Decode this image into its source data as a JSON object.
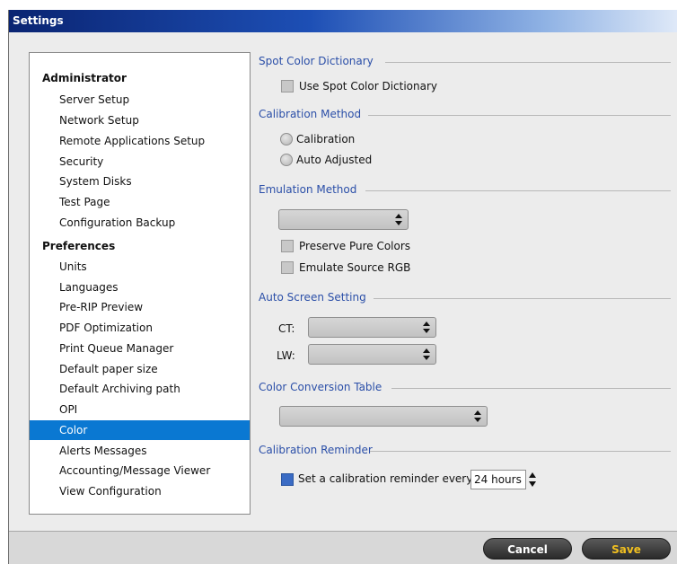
{
  "window": {
    "title": "Settings"
  },
  "tree": {
    "groups": [
      {
        "label": "Administrator",
        "items": [
          "Server Setup",
          "Network Setup",
          "Remote Applications Setup",
          "Security",
          "System Disks",
          "Test Page",
          "Configuration Backup"
        ]
      },
      {
        "label": "Preferences",
        "items": [
          "Units",
          "Languages",
          "Pre-RIP Preview",
          "PDF Optimization",
          "Print Queue Manager",
          "Default paper size",
          "Default Archiving path",
          "OPI",
          "Color",
          "Alerts Messages",
          "Accounting/Message Viewer",
          "View Configuration"
        ]
      }
    ],
    "selected": "Color"
  },
  "spot_color": {
    "header": "Spot Color Dictionary",
    "checkbox_label": "Use Spot Color Dictionary",
    "checked": false
  },
  "calibration_method": {
    "header": "Calibration Method",
    "options": [
      "Calibration",
      "Auto Adjusted"
    ]
  },
  "emulation_method": {
    "header": "Emulation Method",
    "select_value": "",
    "preserve_label": "Preserve Pure Colors",
    "emulate_label": "Emulate Source RGB"
  },
  "auto_screen": {
    "header": "Auto Screen Setting",
    "ct_label": "CT:",
    "lw_label": "LW:",
    "ct_value": "",
    "lw_value": ""
  },
  "color_conversion": {
    "header": "Color Conversion Table",
    "select_value": ""
  },
  "calibration_reminder": {
    "header": "Calibration Reminder",
    "checkbox_label": "Set a calibration reminder every",
    "checked": true,
    "interval_value": "24 hours"
  },
  "footer": {
    "cancel_label": "Cancel",
    "save_label": "Save"
  },
  "colors": {
    "selection": "#0a78d2",
    "section_header": "#2b4fa8",
    "save_text": "#f2c020"
  },
  "icons": [
    "updown-arrows-icon"
  ]
}
